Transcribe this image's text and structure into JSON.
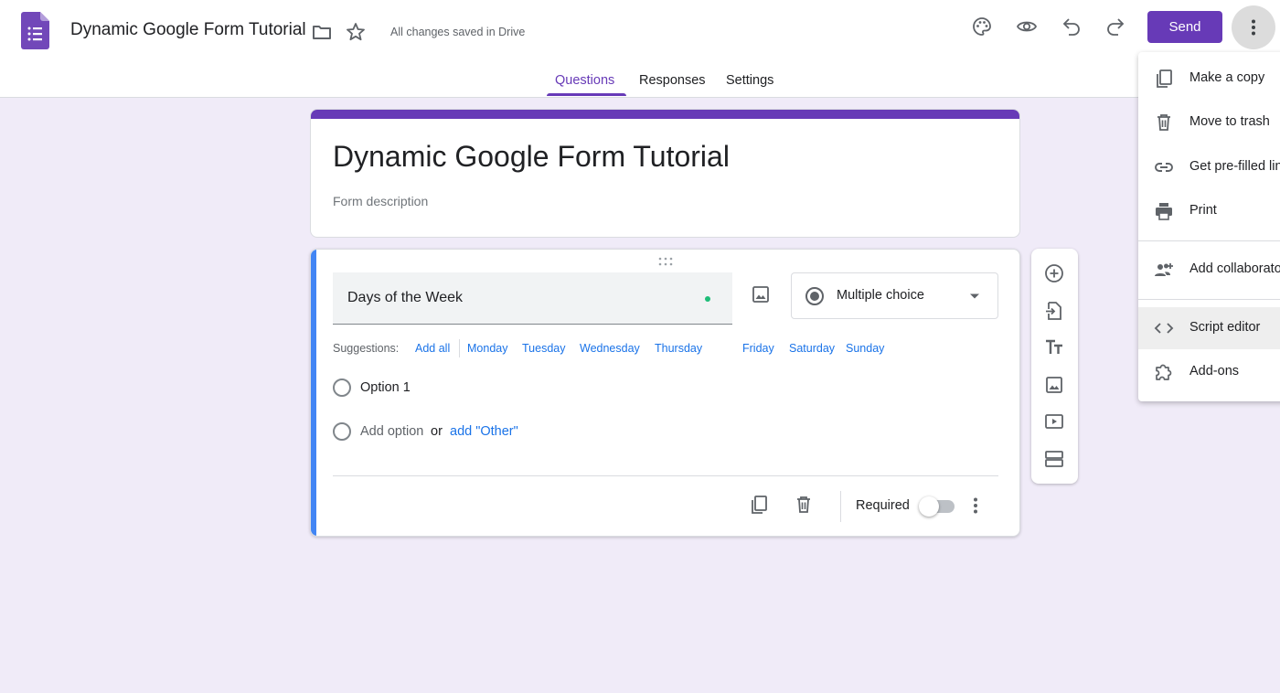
{
  "header": {
    "doc_title": "Dynamic Google Form Tutorial",
    "save_status": "All changes saved in Drive",
    "send_label": "Send"
  },
  "tabs": [
    {
      "label": "Questions",
      "active": true
    },
    {
      "label": "Responses",
      "active": false
    },
    {
      "label": "Settings",
      "active": false
    }
  ],
  "form": {
    "title": "Dynamic Google Form Tutorial",
    "description_placeholder": "Form description"
  },
  "question": {
    "title": "Days of the Week",
    "type": "Multiple choice",
    "suggestions_label": "Suggestions:",
    "suggestions": [
      "Add all",
      "Monday",
      "Tuesday",
      "Wednesday",
      "Thursday",
      "Friday",
      "Saturday",
      "Sunday"
    ],
    "options": [
      "Option 1"
    ],
    "add_option": "Add option",
    "or_text": "or",
    "add_other": "add \"Other\"",
    "required_label": "Required",
    "required": false
  },
  "menu": {
    "items": [
      {
        "label": "Make a copy",
        "icon": "copy-icon"
      },
      {
        "label": "Move to trash",
        "icon": "trash-icon"
      },
      {
        "label": "Get pre-filled link",
        "icon": "link-icon"
      },
      {
        "label": "Print",
        "icon": "print-icon"
      },
      {
        "label": "Add collaborators",
        "icon": "add-people-icon"
      },
      {
        "label": "Script editor",
        "icon": "code-icon"
      },
      {
        "label": "Add-ons",
        "icon": "puzzle-icon"
      }
    ]
  },
  "colors": {
    "accent": "#673ab7",
    "background": "#f0ebf8",
    "question_bar": "#4285f4",
    "link": "#1a73e8"
  }
}
